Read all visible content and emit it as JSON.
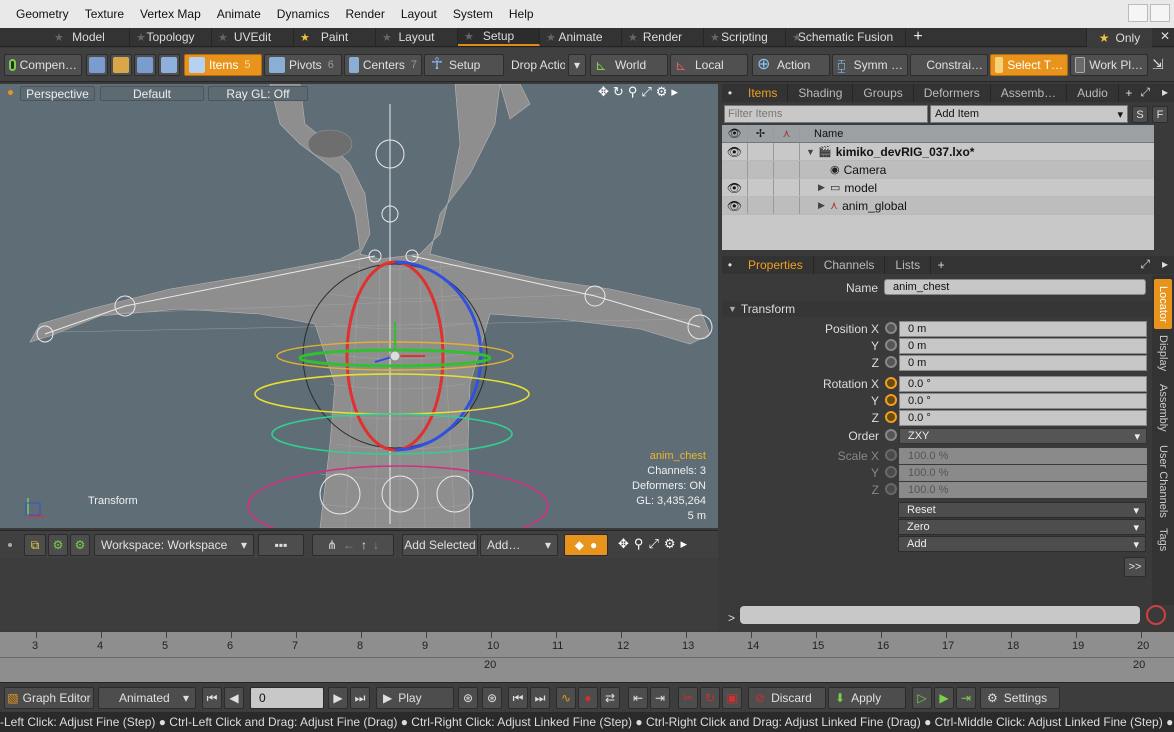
{
  "menu": [
    "Geometry",
    "Texture",
    "Vertex Map",
    "Animate",
    "Dynamics",
    "Render",
    "Layout",
    "System",
    "Help"
  ],
  "layout_tabs": [
    {
      "label": "Model",
      "star": "plain"
    },
    {
      "label": "Topology",
      "star": "plain"
    },
    {
      "label": "UVEdit",
      "star": "plain"
    },
    {
      "label": "Paint",
      "star": "gold"
    },
    {
      "label": "Layout",
      "star": "plain"
    },
    {
      "label": "Setup",
      "star": "plain",
      "active": true
    },
    {
      "label": "Animate",
      "star": "plain"
    },
    {
      "label": "Render",
      "star": "plain"
    },
    {
      "label": "Scripting",
      "star": "plain"
    },
    {
      "label": "Schematic Fusion",
      "star": "plain"
    }
  ],
  "layout_only_label": "Only",
  "toolbar": {
    "compen": "Compen…",
    "items": "Items",
    "items_num": "5",
    "pivots": "Pivots",
    "pivots_num": "6",
    "centers": "Centers",
    "centers_num": "7",
    "setup": "Setup",
    "drop_action": "Drop Action",
    "world": "World",
    "local": "Local",
    "action": "Action",
    "symm": "Symm …",
    "constrai": "Constrai…",
    "select_t": "Select T…",
    "work_pl": "Work Pl…"
  },
  "viewport": {
    "perspective": "Perspective",
    "default": "Default",
    "raygl": "Ray GL: Off",
    "selected_item": "anim_chest",
    "channels": "Channels: 3",
    "deformers": "Deformers: ON",
    "gl": "GL: 3,435,264",
    "distance": "5 m",
    "tool_label": "Transform"
  },
  "vptool": {
    "workspace": "Workspace: Workspace",
    "add_selected": "Add Selected",
    "add": "Add…"
  },
  "items_panel": {
    "tabs": [
      "Items",
      "Shading",
      "Groups",
      "Deformers",
      "Assemb…",
      "Audio"
    ],
    "filter_placeholder": "Filter Items",
    "add_item": "Add Item",
    "btn_s": "S",
    "btn_f": "F",
    "col_name": "Name",
    "rows": [
      {
        "name": "kimiko_devRIG_037.lxo*",
        "level": 0,
        "eye": true,
        "bold": true,
        "icon": "scene-icon"
      },
      {
        "name": "Camera",
        "level": 1,
        "eye": false,
        "icon": "camera-icon"
      },
      {
        "name": "model",
        "level": 1,
        "eye": true,
        "icon": "folder-icon"
      },
      {
        "name": "anim_global",
        "level": 1,
        "eye": true,
        "icon": "locator-icon"
      }
    ]
  },
  "props_panel": {
    "tabs": [
      "Properties",
      "Channels",
      "Lists"
    ],
    "name_label": "Name",
    "name_value": "anim_chest",
    "section": "Transform",
    "position_label": "Position X",
    "y_label": "Y",
    "z_label": "Z",
    "position": [
      "0 m",
      "0 m",
      "0 m"
    ],
    "rotation_label": "Rotation X",
    "rotation": [
      "0.0 °",
      "0.0 °",
      "0.0 °"
    ],
    "order_label": "Order",
    "order_value": "ZXY",
    "scale_label": "Scale X",
    "scale": [
      "100.0 %",
      "100.0 %",
      "100.0 %"
    ],
    "reset": "Reset",
    "zero": "Zero",
    "add": "Add",
    "more": ">>",
    "side_tabs": [
      "Locator",
      "Display",
      "Assembly",
      "User Channels",
      "Tags"
    ]
  },
  "timeline": {
    "ticks": [
      "3",
      "4",
      "5",
      "6",
      "7",
      "8",
      "9",
      "10",
      "11",
      "12",
      "13",
      "14",
      "15",
      "16",
      "17",
      "18",
      "19",
      "20"
    ],
    "lower_left": "20",
    "lower_right": "20"
  },
  "transport": {
    "graph_editor": "Graph Editor",
    "animated": "Animated",
    "frame": "0",
    "play": "Play",
    "discard": "Discard",
    "apply": "Apply",
    "settings": "Settings"
  },
  "status": "-Left Click: Adjust Fine (Step) ● Ctrl-Left Click and Drag: Adjust Fine (Drag) ● Ctrl-Right Click: Adjust Linked Fine (Step) ● Ctrl-Right Click and Drag: Adjust Linked Fine (Drag) ● Ctrl-Middle Click: Adjust Linked Fine (Step) ● Ctrl-Middle Click and",
  "colors": {
    "accent": "#e8941c",
    "viewport_bg": "#5f6d76",
    "selected_text": "#f0b429"
  }
}
